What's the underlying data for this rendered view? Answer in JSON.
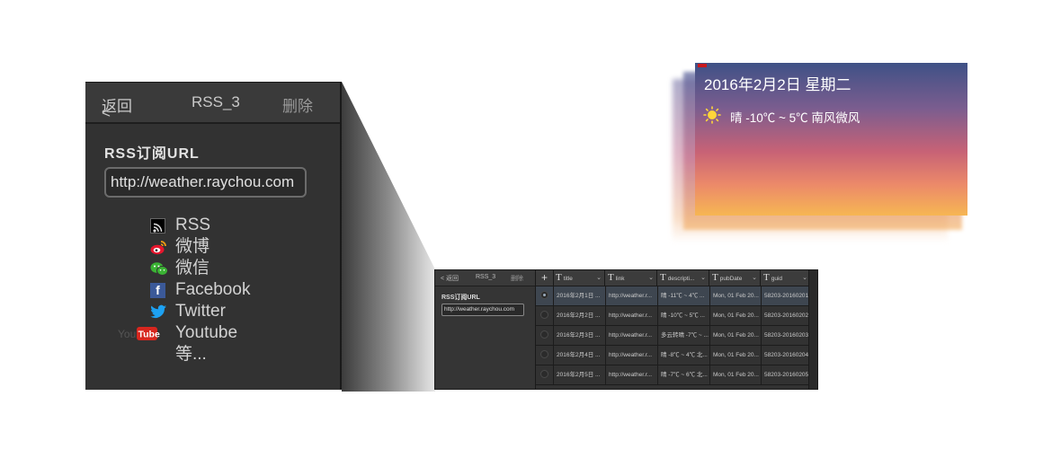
{
  "zoom_panel": {
    "back_label": "返回",
    "title": "RSS_3",
    "delete_label": "删除",
    "url_label": "RSS订阅URL",
    "url_value": "http://weather.raychou.com",
    "sources": [
      {
        "icon": "rss-icon",
        "label": "RSS"
      },
      {
        "icon": "weibo-icon",
        "label": "微博"
      },
      {
        "icon": "wechat-icon",
        "label": "微信"
      },
      {
        "icon": "facebook-icon",
        "label": "Facebook"
      },
      {
        "icon": "twitter-icon",
        "label": "Twitter"
      },
      {
        "icon": "youtube-icon",
        "label": "Youtube"
      },
      {
        "icon": "",
        "label": "等..."
      }
    ]
  },
  "app": {
    "back_label": "< 返回",
    "title": "RSS_3",
    "delete_label": "删除",
    "url_label": "RSS订阅URL",
    "url_value": "http://weather.raychou.com",
    "add_symbol": "+",
    "columns": [
      "title",
      "link",
      "descripti...",
      "pubDate",
      "guid"
    ],
    "rows": [
      [
        "2016年2月1日 ...",
        "http://weather.r...",
        "晴 -11℃ ~ 4℃ ...",
        "Mon, 01 Feb 20...",
        "58203-20160201"
      ],
      [
        "2016年2月2日 ...",
        "http://weather.r...",
        "晴 -10℃ ~ 5℃ ...",
        "Mon, 01 Feb 20...",
        "58203-20160202"
      ],
      [
        "2016年2月3日 ...",
        "http://weather.r...",
        "多云转晴 -7℃ ~ ...",
        "Mon, 01 Feb 20...",
        "58203-20160203"
      ],
      [
        "2016年2月4日 ...",
        "http://weather.r...",
        "晴 -8℃ ~ 4℃ 北...",
        "Mon, 01 Feb 20...",
        "58203-20160204"
      ],
      [
        "2016年2月5日 ...",
        "http://weather.r...",
        "晴 -7℃ ~ 6℃ 北...",
        "Mon, 01 Feb 20...",
        "58203-20160205"
      ]
    ],
    "selected_row": 0
  },
  "weather": {
    "date": "2016年2月2日 星期二",
    "description": "晴 -10℃ ~ 5℃ 南风微风",
    "icon": "sun-icon"
  }
}
